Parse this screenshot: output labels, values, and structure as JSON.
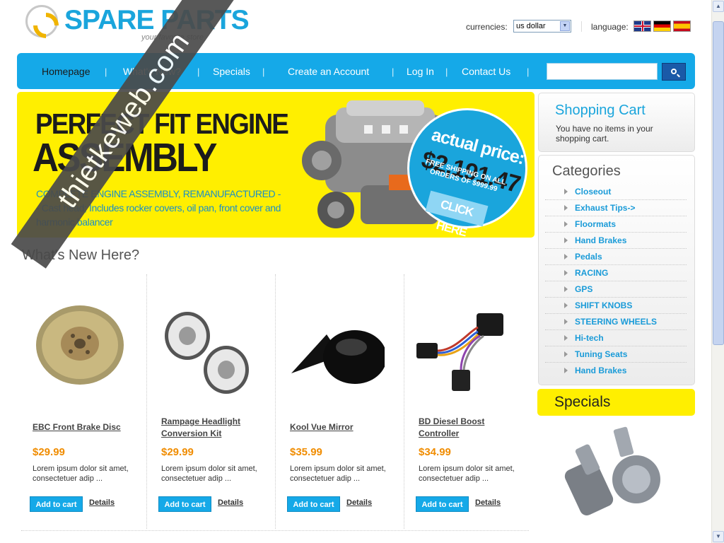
{
  "header": {
    "logo_text": "SPARE PARTS",
    "logo_tagline": "your favorite store",
    "currency_label": "currencies:",
    "currency_value": "us dollar",
    "language_label": "language:",
    "languages": [
      "english",
      "german",
      "spanish"
    ]
  },
  "nav": {
    "items": [
      {
        "label": "Homepage",
        "active": true
      },
      {
        "label": "What's New?",
        "active": false
      },
      {
        "label": "Specials",
        "active": false
      },
      {
        "label": "Create an Account",
        "active": false
      },
      {
        "label": "Log In",
        "active": false
      },
      {
        "label": "Contact Us",
        "active": false
      }
    ],
    "search_value": "",
    "search_button_icon": "search-icon"
  },
  "banner": {
    "title_line1": "PERFECT FIT ENGINE",
    "title_line2": "ASSEMBLY",
    "description": "COMPLETE ENGINE ASSEMBLY, REMANUFACTURED -- Cast head; Includes rocker covers, oil pan, front cover and harmonic balancer",
    "actual_price_label": "actual price:",
    "actual_price": "$2,191.47",
    "shipping_note": "FREE SHIPPING ON ALL ORDERS OF $999.99",
    "cta": "CLICK HERE"
  },
  "whats_new": {
    "title": "What's New Here?",
    "products": [
      {
        "name": "EBC Front Brake Disc",
        "price": "$29.99",
        "description": "Lorem ipsum dolor sit amet, consectetuer adip ...",
        "add_to_cart": "Add to cart",
        "details": "Details",
        "image_icon": "brake-disc"
      },
      {
        "name": "Rampage Headlight Conversion Kit",
        "price": "$29.99",
        "description": "Lorem ipsum dolor sit amet, consectetuer adip ...",
        "add_to_cart": "Add to cart",
        "details": "Details",
        "image_icon": "headlights"
      },
      {
        "name": "Kool Vue Mirror",
        "price": "$35.99",
        "description": "Lorem ipsum dolor sit amet, consectetuer adip ...",
        "add_to_cart": "Add to cart",
        "details": "Details",
        "image_icon": "car-mirror"
      },
      {
        "name": "BD Diesel Boost Controller",
        "price": "$34.99",
        "description": "Lorem ipsum dolor sit amet, consectetuer adip ...",
        "add_to_cart": "Add to cart",
        "details": "Details",
        "image_icon": "boost-controller"
      }
    ]
  },
  "sidebar": {
    "cart_title": "Shopping Cart",
    "cart_empty": "You have no items in your shopping cart.",
    "categories_title": "Categories",
    "categories": [
      "Closeout",
      "Exhaust Tips->",
      "Floormats",
      "Hand Brakes",
      "Pedals",
      "RACING",
      "GPS",
      "SHIFT KNOBS",
      "STEERING WHEELS",
      "Hi-tech",
      "Tuning Seats",
      "Hand Brakes"
    ],
    "specials_title": "Specials"
  },
  "watermark": "thietkeweb.com",
  "colors": {
    "accent_blue": "#15a9e8",
    "banner_yellow": "#ffef00",
    "price_orange": "#f08c00",
    "category_link": "#1a9bd8"
  }
}
